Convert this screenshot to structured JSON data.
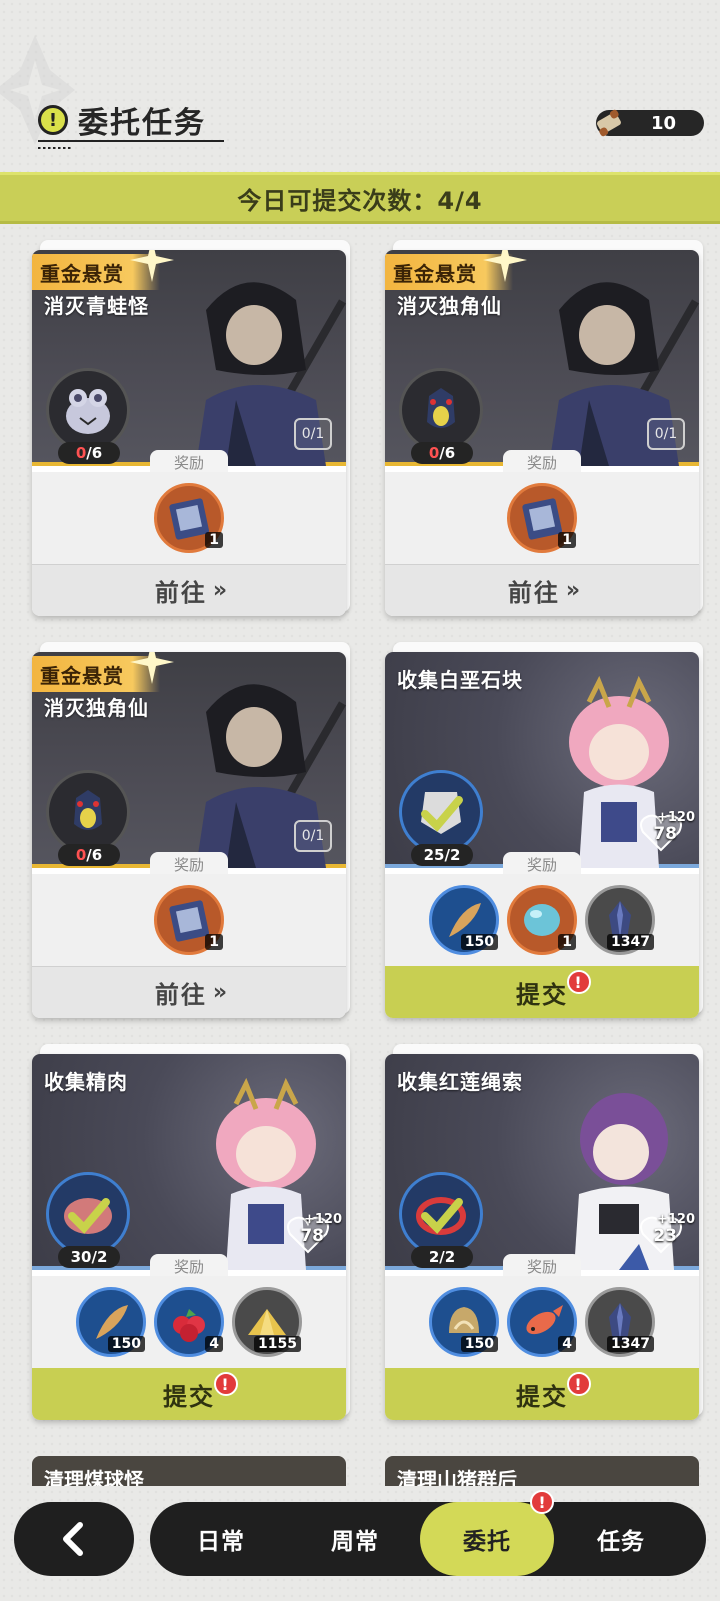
{
  "header": {
    "title": "委托任务",
    "scroll_count": "10"
  },
  "banner": {
    "text": "今日可提交次数：4/4"
  },
  "cards": [
    {
      "tag": "重金悬赏",
      "title": "消灭青蛙怪",
      "count_current": "0",
      "count_total": "/6",
      "progress": "0/1",
      "reward_label": "奖励",
      "rewards": [
        {
          "icon": "book-icon",
          "qty": "1"
        }
      ],
      "action": "前往",
      "action_arrows": "»"
    },
    {
      "tag": "重金悬赏",
      "title": "消灭独角仙",
      "count_current": "0",
      "count_total": "/6",
      "progress": "0/1",
      "reward_label": "奖励",
      "rewards": [
        {
          "icon": "book-icon",
          "qty": "1"
        }
      ],
      "action": "前往",
      "action_arrows": "»"
    },
    {
      "tag": "重金悬赏",
      "title": "消灭独角仙",
      "count_current": "0",
      "count_total": "/6",
      "progress": "0/1",
      "reward_label": "奖励",
      "rewards": [
        {
          "icon": "book-icon",
          "qty": "1"
        }
      ],
      "action": "前往",
      "action_arrows": "»"
    },
    {
      "title": "收集白垩石块",
      "count": "25/2",
      "heart_value": "78",
      "heart_plus": "+120",
      "reward_label": "奖励",
      "rewards": [
        {
          "icon": "feather-icon",
          "qty": "150"
        },
        {
          "icon": "orb-icon",
          "qty": "1"
        },
        {
          "icon": "crystal-icon",
          "qty": "1347"
        }
      ],
      "action": "提交"
    },
    {
      "title": "收集精肉",
      "count": "30/2",
      "heart_value": "78",
      "heart_plus": "+120",
      "reward_label": "奖励",
      "rewards": [
        {
          "icon": "feather-icon",
          "qty": "150"
        },
        {
          "icon": "berries-icon",
          "qty": "4"
        },
        {
          "icon": "gold-pile-icon",
          "qty": "1155"
        }
      ],
      "action": "提交"
    },
    {
      "title": "收集红莲绳索",
      "count": "2/2",
      "heart_value": "23",
      "heart_plus": "+120",
      "reward_label": "奖励",
      "rewards": [
        {
          "icon": "scale-shell-icon",
          "qty": "150"
        },
        {
          "icon": "fish-icon",
          "qty": "4"
        },
        {
          "icon": "crystal-icon",
          "qty": "1347"
        }
      ],
      "action": "提交"
    }
  ],
  "peek_cards": [
    "清理煤球怪",
    "清理山猪群后"
  ],
  "nav": {
    "tabs": [
      "日常",
      "周常",
      "委托",
      "任务"
    ],
    "active": "委托"
  },
  "colors": {
    "accent": "#c8cf52",
    "bounty": "#f2b33d",
    "alert": "#e23b3b"
  }
}
